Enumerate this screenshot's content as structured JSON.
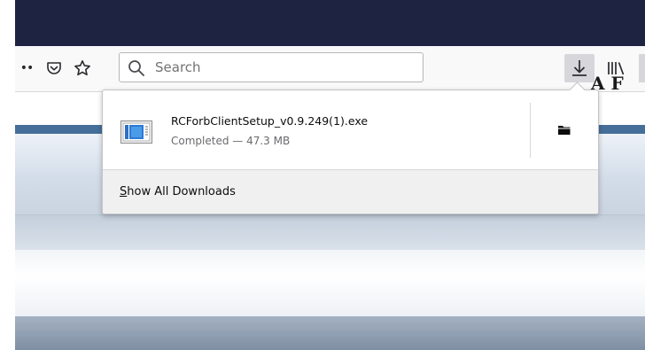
{
  "toolbar": {
    "overflow_label": "••",
    "search": {
      "placeholder": "Search",
      "value": ""
    }
  },
  "page": {
    "heading_fragment": "A F"
  },
  "downloads_panel": {
    "items": [
      {
        "filename": "RCForbClientSetup_v0.9.249(1).exe",
        "status": "Completed — 47.3 MB",
        "icon": "installer-file-icon"
      }
    ],
    "footer": {
      "access_key": "S",
      "label_rest": "how All Downloads"
    }
  },
  "colors": {
    "titlebar": "#1f2342",
    "toolbar": "#f9f9fa",
    "active_button": "#d7d7db",
    "page_band": "#456f99"
  }
}
